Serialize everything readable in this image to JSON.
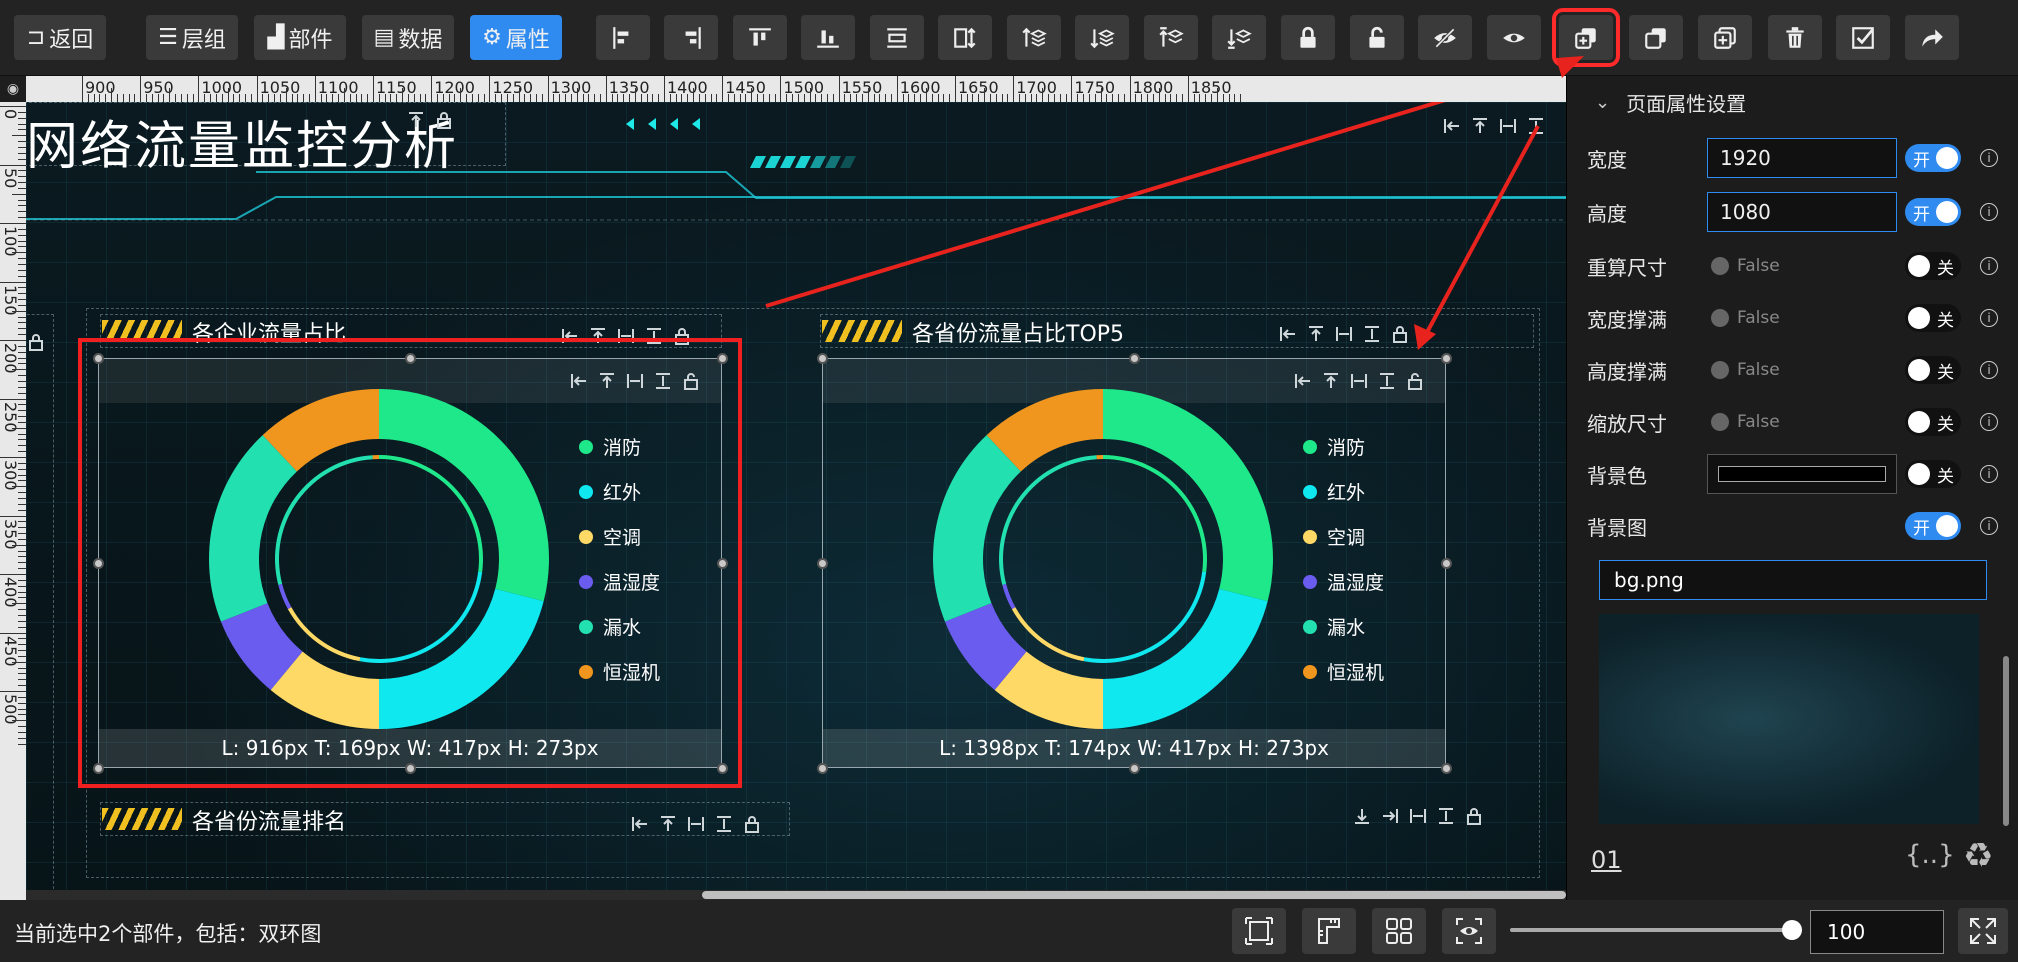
{
  "toolbar": {
    "back_label": "返回",
    "layers_label": "层组",
    "widgets_label": "部件",
    "data_label": "数据",
    "props_label": "属性",
    "icons": [
      "align-left-icon",
      "align-right-icon",
      "align-top-icon",
      "align-bottom-icon",
      "distribute-horizontal-icon",
      "distribute-vertical-icon",
      "bring-forward-icon",
      "send-backward-icon",
      "bring-to-front-icon",
      "send-to-back-icon",
      "lock-icon",
      "unlock-icon",
      "hide-icon",
      "show-icon",
      "group-icon",
      "copy-icon",
      "paste-icon",
      "delete-icon",
      "select-icon",
      "redo-icon"
    ]
  },
  "rulers": {
    "h_labels": [
      "900",
      "950",
      "1000",
      "1050",
      "1100",
      "1150",
      "1200",
      "1250",
      "1300",
      "1350",
      "1400",
      "1450",
      "1500",
      "1550",
      "1600",
      "1650",
      "1700",
      "1750",
      "1800",
      "1850"
    ],
    "v_labels": [
      "0",
      "50",
      "100",
      "150",
      "200",
      "250",
      "300",
      "350",
      "400",
      "450",
      "500"
    ]
  },
  "canvas": {
    "page_title": "网络流量监控分析",
    "widgets": [
      {
        "title": "各企业流量占比",
        "info": "L: 916px T: 169px W: 417px H: 273px"
      },
      {
        "title": "各省份流量占比TOP5",
        "info": "L: 1398px T: 174px W: 417px H: 273px"
      }
    ],
    "bottom_widget_title": "各省份流量排名",
    "legend": [
      {
        "label": "消防",
        "color": "#1ee88a"
      },
      {
        "label": "红外",
        "color": "#10e8f0"
      },
      {
        "label": "空调",
        "color": "#ffd966"
      },
      {
        "label": "温湿度",
        "color": "#6b5cf0"
      },
      {
        "label": "漏水",
        "color": "#22e0b0"
      },
      {
        "label": "恒湿机",
        "color": "#f0961e"
      }
    ]
  },
  "chart_data": {
    "type": "pie",
    "variant": "double-ring",
    "outer_ring": {
      "labels": [
        "消防",
        "红外",
        "空调",
        "温湿度",
        "漏水",
        "恒湿机"
      ],
      "values": [
        29,
        21,
        11,
        8,
        19,
        12
      ]
    },
    "inner_ring": {
      "labels": [
        "消防",
        "红外",
        "空调",
        "温湿度",
        "漏水",
        "恒湿机"
      ],
      "values": [
        27,
        26,
        14,
        4,
        28,
        1
      ]
    },
    "legend_position": "right"
  },
  "panel": {
    "section_title": "页面属性设置",
    "width_label": "宽度",
    "width_value": "1920",
    "height_label": "高度",
    "height_value": "1080",
    "recalc_label": "重算尺寸",
    "fill_width_label": "宽度撑满",
    "fill_height_label": "高度撑满",
    "zoom_label": "缩放尺寸",
    "bgcolor_label": "背景色",
    "bgimage_label": "背景图",
    "false_text": "False",
    "on_text": "开",
    "off_text": "关",
    "bg_file": "bg.png",
    "footer_num": "01"
  },
  "status": {
    "text": "当前选中2个部件，包括：双环图",
    "zoom_value": "100",
    "zoom_level": 100
  },
  "colors": {
    "accent": "#2f8bf0",
    "highlight_red": "#f02020",
    "arrow_red": "#e8231e"
  }
}
